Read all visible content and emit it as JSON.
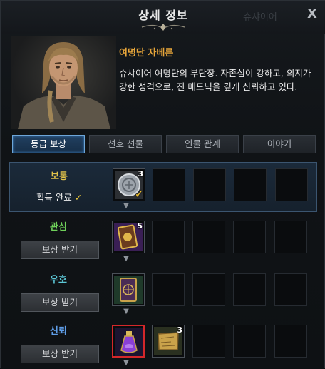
{
  "window": {
    "title": "상세 정보",
    "ghost_title": "슈샤이어",
    "close_label": "X"
  },
  "npc": {
    "name": "여명단 자베른",
    "description": "슈샤이어 여명단의 부단장. 자존심이 강하고, 의지가 강한 성격으로, 진 매드닉을 깊게 신뢰하고 있다.",
    "portrait_icon": "character-portrait"
  },
  "tabs": [
    {
      "label": "등급 보상",
      "active": true
    },
    {
      "label": "선호 선물",
      "active": false
    },
    {
      "label": "인물 관계",
      "active": false
    },
    {
      "label": "이야기",
      "active": false
    }
  ],
  "tiers": [
    {
      "label": "보통",
      "color": "#e2c34a",
      "status": "획득 완료",
      "status_icon": "check-icon",
      "items": [
        {
          "icon": "coin-icon",
          "qty": "3",
          "claimed": true
        }
      ]
    },
    {
      "label": "관심",
      "color": "#6fd05a",
      "button": "보상 받기",
      "items": [
        {
          "icon": "card-pack-icon",
          "qty": "5"
        }
      ]
    },
    {
      "label": "우호",
      "color": "#5cc7d6",
      "button": "보상 받기",
      "items": [
        {
          "icon": "card-icon",
          "qty": ""
        }
      ]
    },
    {
      "label": "신뢰",
      "color": "#5f9ee8",
      "button": "보상 받기",
      "items": [
        {
          "icon": "potion-icon",
          "qty": "",
          "selected": true
        },
        {
          "icon": "map-scroll-icon",
          "qty": "3"
        }
      ]
    }
  ],
  "colors": {
    "accent_name": "#e7a53a",
    "active_tab": "#214061",
    "selected_border": "#d4272a"
  }
}
